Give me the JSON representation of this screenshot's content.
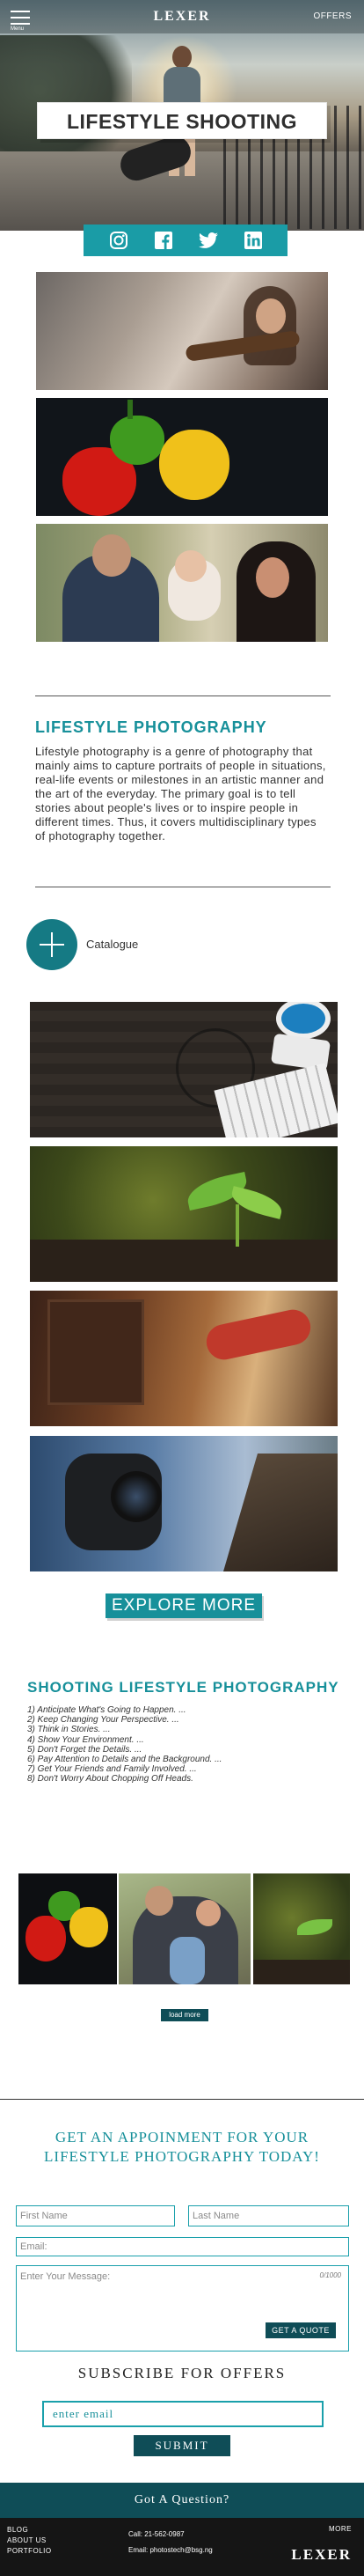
{
  "nav": {
    "menu_caption": "Menu",
    "brand": "LEXER",
    "offers_link": "OFFERS"
  },
  "hero": {
    "title": "LIFESTYLE SHOOTING"
  },
  "social": {
    "icons": [
      "instagram-icon",
      "facebook-icon",
      "twitter-icon",
      "linkedin-icon"
    ],
    "bar_color": "#1a9ca6"
  },
  "about": {
    "heading": "LIFESTYLE PHOTOGRAPHY",
    "body": "Lifestyle photography is a genre of photography that mainly aims to capture portraits of people in situations, real-life events or milestones in an artistic manner and the art of the everyday. The primary goal is to tell stories about people's lives or to inspire people in different times. Thus, it covers multidisciplinary types of photography together."
  },
  "catalogue": {
    "label": "Catalogue"
  },
  "explore": {
    "label": "EXPLORE MORE"
  },
  "shooting": {
    "heading": "SHOOTING LIFESTYLE PHOTOGRAPHY",
    "steps": [
      "1) Anticipate What's Going to Happen. ...",
      "2) Keep Changing Your Perspective. ...",
      "3) Think in Stories. ...",
      "4) Show Your Environment. ...",
      "5) Don't Forget the Details. ...",
      "6) Pay Attention to Details and the Background. ...",
      "7) Get Your Friends and Family Involved. ...",
      "8) Don't Worry About Chopping Off Heads."
    ],
    "load_more": "load more"
  },
  "contact": {
    "heading": "GET AN APPOINMENT FOR YOUR LIFESTYLE PHOTOGRAPHY TODAY!",
    "first_name_placeholder": "First Name",
    "last_name_placeholder": "Last Name",
    "email_placeholder": "Email:",
    "message_placeholder": "Enter Your Message:",
    "message_counter": "0/1000",
    "quote_button": "GET A QUOTE"
  },
  "subscribe": {
    "heading": "SUBSCRIBE FOR OFFERS",
    "email_placeholder": "enter email",
    "submit": "SUBMIT"
  },
  "footer": {
    "question": "Got A Question?",
    "links": [
      "BLOG",
      "ABOUT US",
      "PORTFOLIO"
    ],
    "call": "Call: 21-562-0987",
    "email": "Email: photostech@bsg.ng",
    "more": "MORE",
    "brand": "LEXER"
  },
  "colors": {
    "accent": "#17909a",
    "dark_teal": "#0f4d57",
    "footer_bg": "#151515"
  }
}
